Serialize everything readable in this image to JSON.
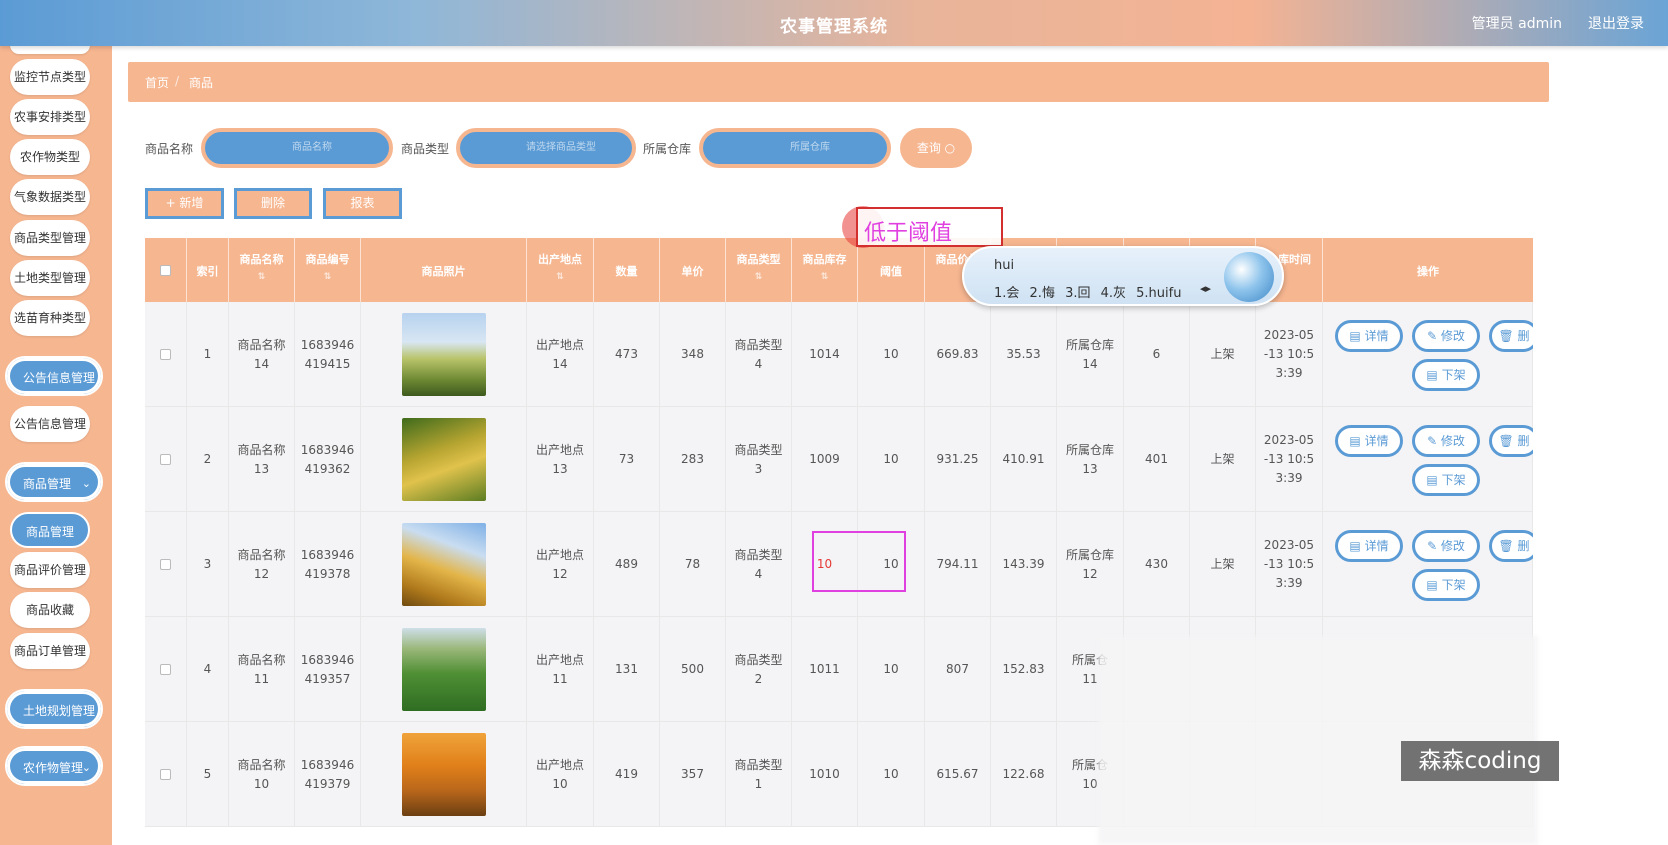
{
  "header": {
    "title": "农事管理系统",
    "user": "管理员 admin",
    "logout": "退出登录"
  },
  "sidebar": {
    "items": [
      "监控节点类型",
      "农事安排类型",
      "农作物类型",
      "气象数据类型",
      "商品类型管理",
      "土地类型管理",
      "选苗育种类型"
    ],
    "group_notice": "公告信息管理",
    "notice_item": "公告信息管理",
    "group_goods": "商品管理",
    "goods_items": [
      "商品管理",
      "商品评价管理",
      "商品收藏",
      "商品订单管理"
    ],
    "group_land": "土地规划管理",
    "group_crop": "农作物管理"
  },
  "breadcrumb": {
    "home": "首页",
    "sep": "/",
    "current": "商品"
  },
  "search": {
    "name_label": "商品名称",
    "name_placeholder": "商品名称",
    "type_label": "商品类型",
    "type_placeholder": "请选择商品类型",
    "warehouse_label": "所属仓库",
    "warehouse_placeholder": "所属仓库",
    "query_button": "查询 ○"
  },
  "actions": {
    "add": "+ 新增",
    "delete": "删除",
    "report": "报表"
  },
  "table": {
    "headers": [
      "索引",
      "商品名称",
      "商品编号",
      "商品照片",
      "出产地点",
      "数量",
      "单价",
      "商品类型",
      "商品库存",
      "阈值",
      "商品价格",
      "",
      "",
      "",
      "",
      "入库时间",
      "操作"
    ],
    "rows": [
      {
        "index": "1",
        "name": [
          "商品名称",
          "14"
        ],
        "code": [
          "1683946",
          "419415"
        ],
        "origin": [
          "出产地点",
          "14"
        ],
        "qty": "473",
        "v2": "348",
        "type": [
          "商品类型",
          "4"
        ],
        "stock": "1014",
        "threshold": "10",
        "price": "669.83",
        "v3": "35.53",
        "warehouse": [
          "所属仓库",
          "14"
        ],
        "v4": "6",
        "status": "上架",
        "time": [
          "2023-05",
          "-13 10:5",
          "3:39"
        ]
      },
      {
        "index": "2",
        "name": [
          "商品名称",
          "13"
        ],
        "code": [
          "1683946",
          "419362"
        ],
        "origin": [
          "出产地点",
          "13"
        ],
        "qty": "73",
        "v2": "283",
        "type": [
          "商品类型",
          "3"
        ],
        "stock": "1009",
        "threshold": "10",
        "price": "931.25",
        "v3": "410.91",
        "warehouse": [
          "所属仓库",
          "13"
        ],
        "v4": "401",
        "status": "上架",
        "time": [
          "2023-05",
          "-13 10:5",
          "3:39"
        ]
      },
      {
        "index": "3",
        "name": [
          "商品名称",
          "12"
        ],
        "code": [
          "1683946",
          "419378"
        ],
        "origin": [
          "出产地点",
          "12"
        ],
        "qty": "489",
        "v2": "78",
        "type": [
          "商品类型",
          "4"
        ],
        "stock": "10",
        "threshold": "10",
        "price": "794.11",
        "v3": "143.39",
        "warehouse": [
          "所属仓库",
          "12"
        ],
        "v4": "430",
        "status": "上架",
        "time": [
          "2023-05",
          "-13 10:5",
          "3:39"
        ]
      },
      {
        "index": "4",
        "name": [
          "商品名称",
          "11"
        ],
        "code": [
          "1683946",
          "419357"
        ],
        "origin": [
          "出产地点",
          "11"
        ],
        "qty": "131",
        "v2": "500",
        "type": [
          "商品类型",
          "2"
        ],
        "stock": "1011",
        "threshold": "10",
        "price": "807",
        "v3": "152.83",
        "warehouse": [
          "所属仓",
          "11"
        ],
        "v4": "",
        "status": "",
        "time": [
          "",
          "",
          ""
        ]
      },
      {
        "index": "5",
        "name": [
          "商品名称",
          "10"
        ],
        "code": [
          "1683946",
          "419379"
        ],
        "origin": [
          "出产地点",
          "10"
        ],
        "qty": "419",
        "v2": "357",
        "type": [
          "商品类型",
          "1"
        ],
        "stock": "1010",
        "threshold": "10",
        "price": "615.67",
        "v3": "122.68",
        "warehouse": [
          "所属仓",
          "10"
        ],
        "v4": "",
        "status": "",
        "time": [
          "",
          "",
          ""
        ]
      }
    ],
    "op_detail": "详情",
    "op_edit": "修改",
    "op_del": "删",
    "op_off": "下架"
  },
  "ime": {
    "text": "低于阈值",
    "pinyin": "hui",
    "candidates": "1.会 2.悔 3.回 4.灰 5.huifu"
  },
  "watermark": "森森coding",
  "colors": {
    "accent_blue": "#5b9bd5",
    "accent_orange": "#f6b690",
    "ime_text": "#e040e0"
  }
}
